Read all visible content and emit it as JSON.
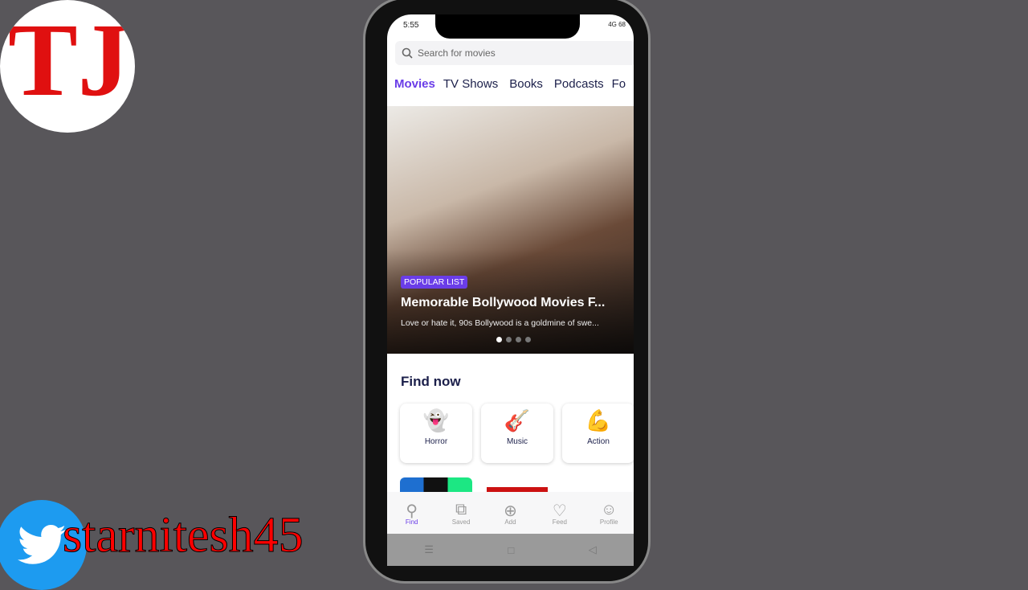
{
  "overlay": {
    "logo_text": "TJ",
    "handle": "starnitesh45"
  },
  "status": {
    "time": "5:55",
    "right": "4G 68"
  },
  "search": {
    "placeholder": "Search for movies"
  },
  "tabs": [
    "Movies",
    "TV Shows",
    "Books",
    "Podcasts",
    "Fo"
  ],
  "hero": {
    "badge": "POPULAR LIST",
    "title": "Memorable Bollywood Movies F...",
    "subtitle": "Love or hate it, 90s Bollywood is a goldmine of swe...",
    "slide_count": 4,
    "active_slide": 1
  },
  "find_now": {
    "title": "Find now",
    "categories": [
      {
        "label": "Horror",
        "icon": "ghost-icon"
      },
      {
        "label": "Music",
        "icon": "guitar-icon"
      },
      {
        "label": "Action",
        "icon": "flexed-arm-icon"
      }
    ]
  },
  "nav": [
    {
      "label": "Find",
      "icon": "search-icon"
    },
    {
      "label": "Saved",
      "icon": "bookmark-icon"
    },
    {
      "label": "Add",
      "icon": "plus-circle-icon"
    },
    {
      "label": "Feed",
      "icon": "heart-icon"
    },
    {
      "label": "Profile",
      "icon": "person-icon"
    }
  ],
  "colors": {
    "accent": "#6a3de8",
    "text": "#1b1f4a"
  }
}
